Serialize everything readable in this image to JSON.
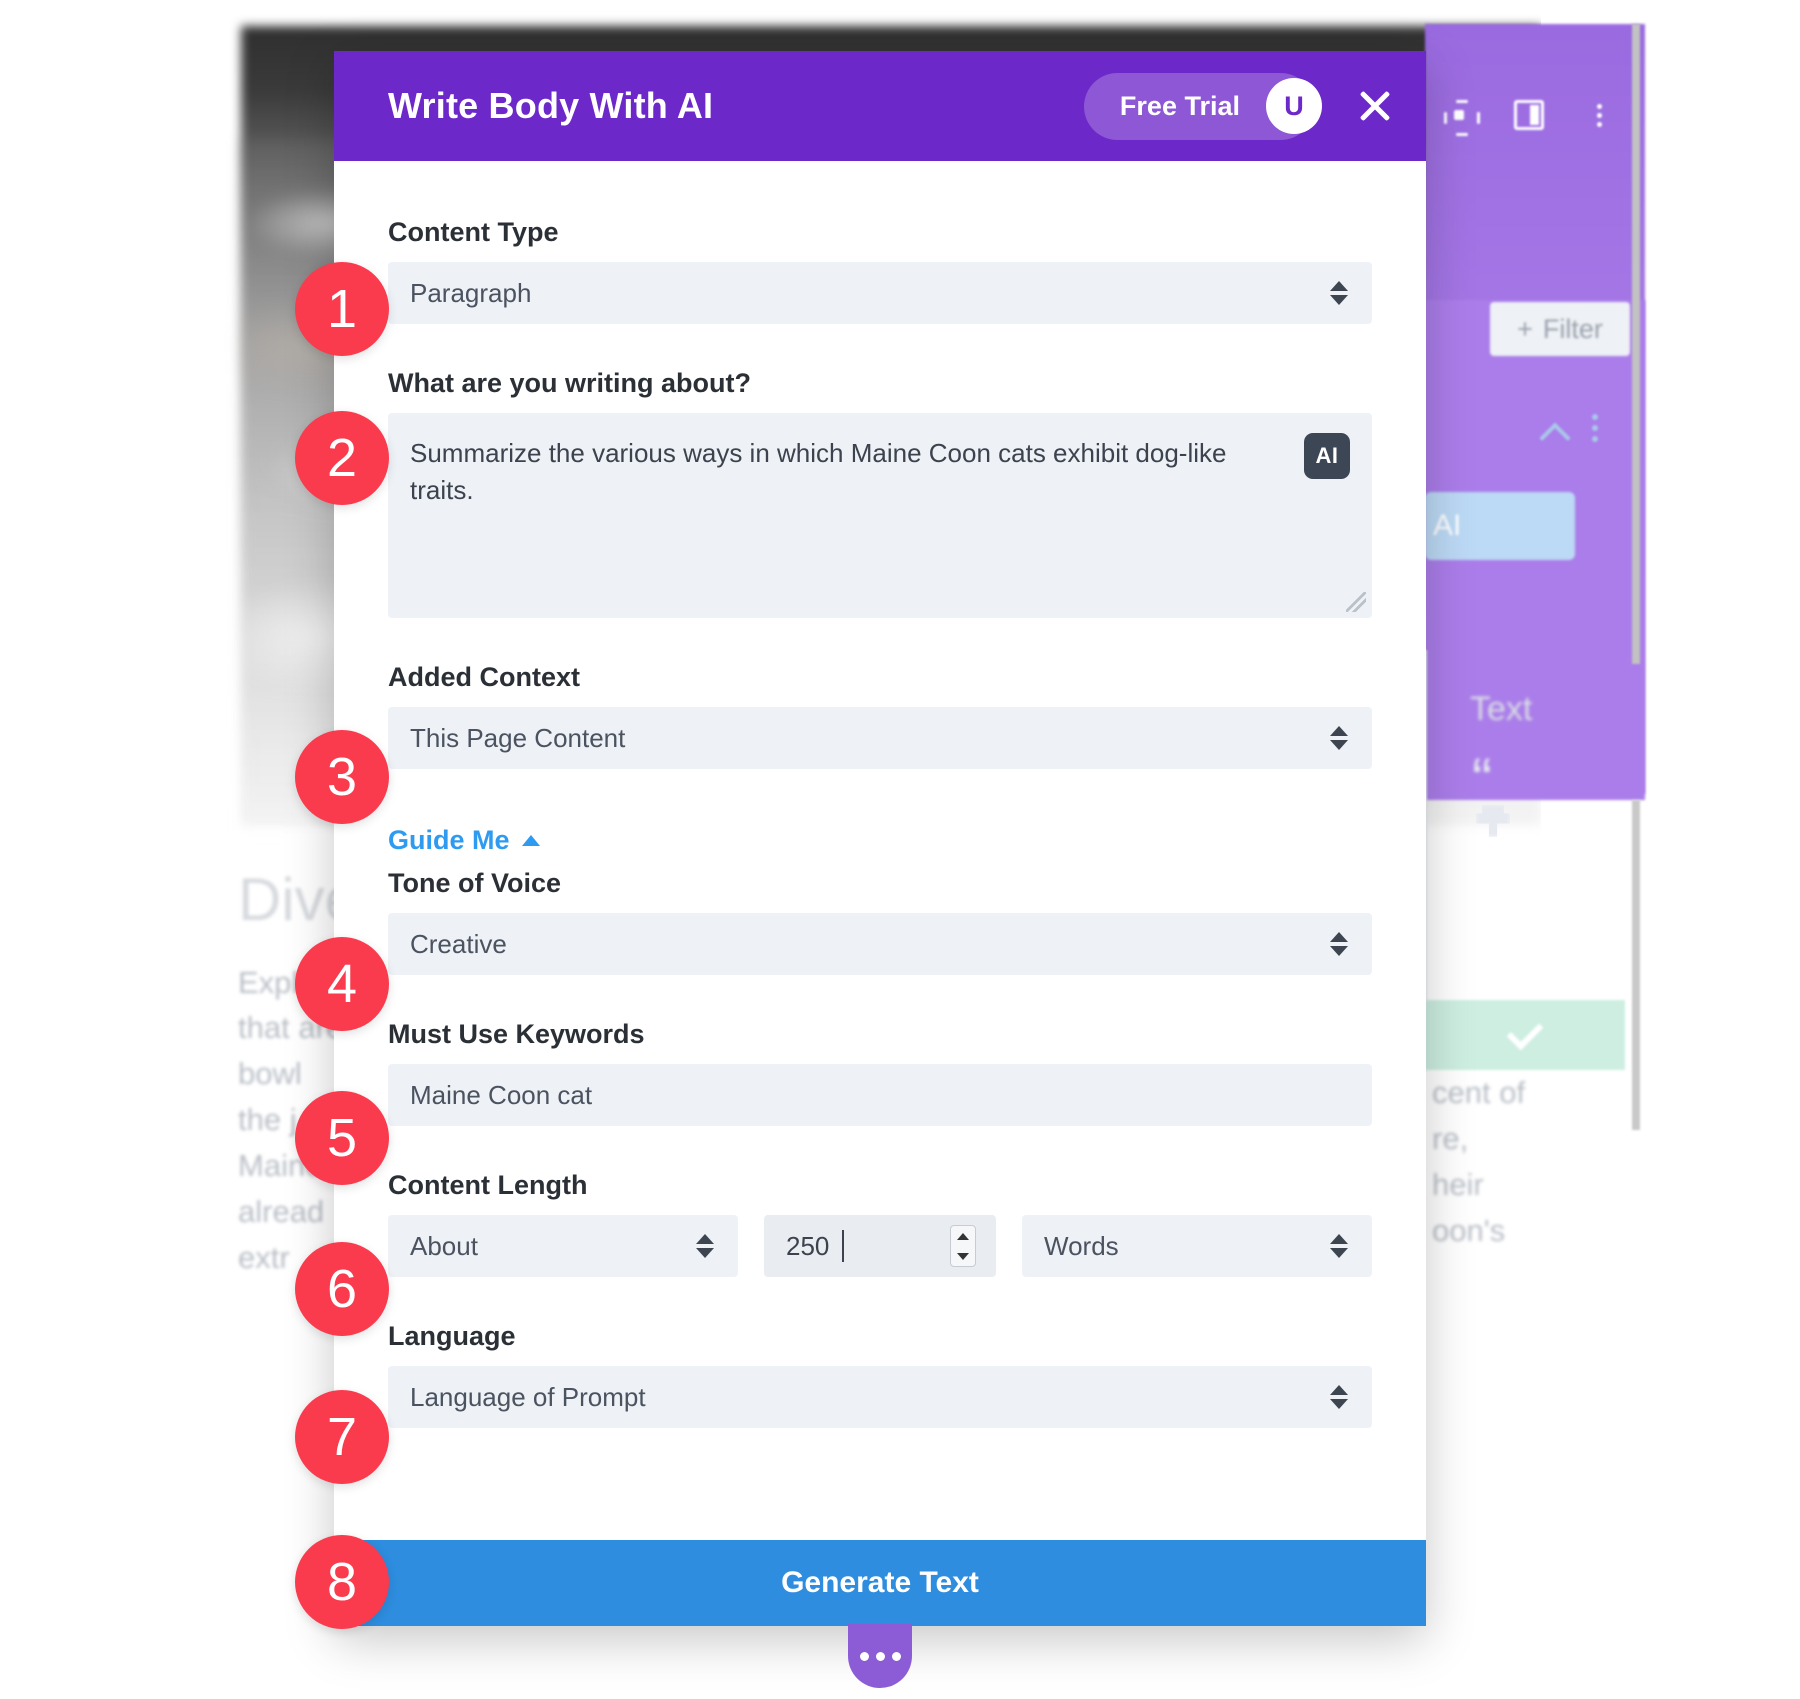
{
  "modal": {
    "title": "Write Body With AI",
    "free_trial_label": "Free Trial",
    "avatar_initial": "U",
    "close_icon": "close-icon",
    "header_bg": "#6d28c9"
  },
  "fields": {
    "content_type": {
      "label": "Content Type",
      "value": "Paragraph",
      "options": [
        "Paragraph"
      ]
    },
    "writing_about": {
      "label": "What are you writing about?",
      "value": "Summarize the various ways in which Maine Coon cats exhibit dog-like traits.",
      "ai_badge": "AI"
    },
    "added_context": {
      "label": "Added Context",
      "value": "This Page Content",
      "options": [
        "This Page Content"
      ]
    },
    "guide_me": {
      "label": "Guide Me",
      "toggle_icon": "triangle-up-icon"
    },
    "tone_of_voice": {
      "label": "Tone of Voice",
      "value": "Creative",
      "options": [
        "Creative"
      ]
    },
    "must_use_keywords": {
      "label": "Must Use Keywords",
      "value": "Maine Coon cat"
    },
    "content_length": {
      "label": "Content Length",
      "qualifier": "About",
      "amount": "250",
      "unit": "Words"
    },
    "language": {
      "label": "Language",
      "value": "Language of Prompt",
      "options": [
        "Language of Prompt"
      ]
    }
  },
  "footer": {
    "generate_label": "Generate Text",
    "accent": "#2e8ddf",
    "drag_handle_icon": "three-dots-icon"
  },
  "callouts": {
    "color": "#f93b4d",
    "items": [
      "1",
      "2",
      "3",
      "4",
      "5",
      "6",
      "7",
      "8"
    ]
  },
  "background": {
    "filter_button": "Filter",
    "text_panel_label": "Text",
    "blue_button_label": "AI",
    "left_text": [
      "Dive",
      "Explo",
      "that are",
      "bowl",
      "the j",
      "Maine C",
      "alread",
      "extr"
    ],
    "right_text": [
      "cent of",
      "re,",
      "heir",
      "oon's"
    ],
    "icons": [
      "frame-icon",
      "layout-icon",
      "three-dots-vertical-icon",
      "chevron-up-icon",
      "quote-icon",
      "brush-icon",
      "check-icon"
    ]
  }
}
